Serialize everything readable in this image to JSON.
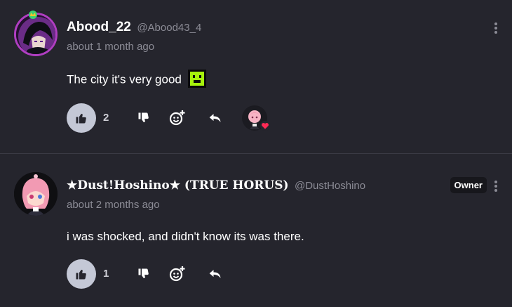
{
  "comments": [
    {
      "username": "Abood_22",
      "handle": "@Abood43_4",
      "time": "about 1 month ago",
      "text": "The city it's very good",
      "emote_icon": "green-face-emote-icon",
      "likes": "2",
      "has_reaction": true,
      "reaction_icon": "heart-icon",
      "accent": "#b03ec2"
    },
    {
      "username": "★Dust!Hoshino★ (TRUE HORUS)",
      "handle": "@DustHoshino",
      "time": "about 2 months ago",
      "text": "i was shocked, and didn't know its was there.",
      "likes": "1",
      "tag": "Owner"
    }
  ],
  "colors": {
    "background": "#25252d",
    "like_button": "#c4c8d6",
    "muted_text": "#8c8c96",
    "heart": "#ff2a55",
    "emote_green": "#a6f20c"
  }
}
